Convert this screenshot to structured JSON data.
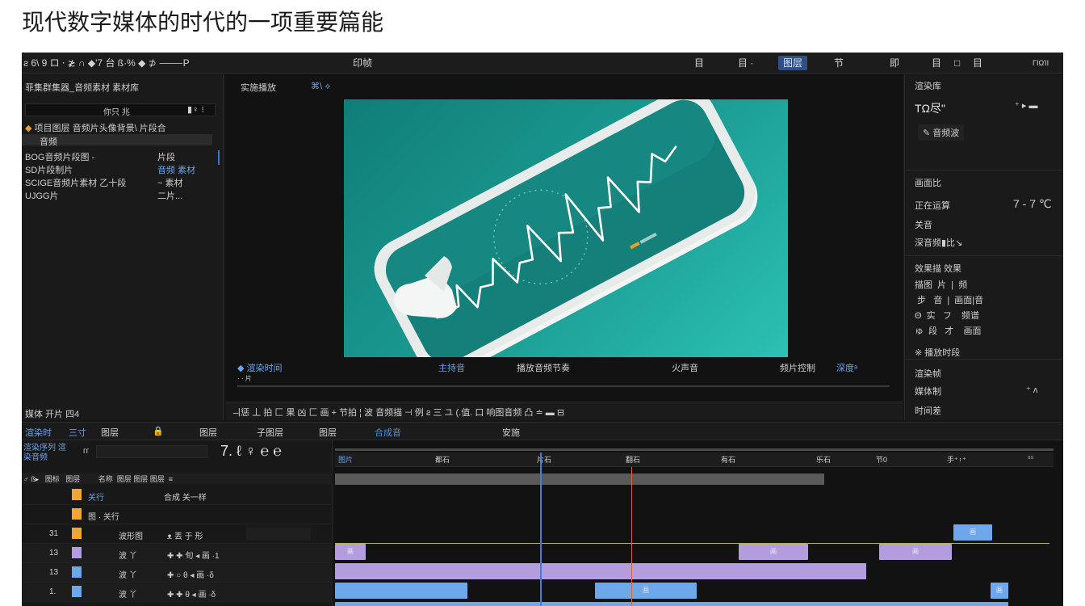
{
  "headline": "现代数字媒体的时代的一项重要篇能",
  "toolbar": {
    "left_icons": "ƨ 6\\ 9   ロ ⸱  ≵ ∩   ◆'7   台 ß·%  ◆  ⊅  ⸻P",
    "item_1": "印帧",
    "item_2": "目",
    "item_3": "目 ·",
    "item_active": "图层",
    "item_4": "节",
    "item_5": "即",
    "item_6": "目",
    "item_7": "□",
    "item_8": "目",
    "item_9": "ΓΙΩΊΙ"
  },
  "left_panel": {
    "title": "菲集群集器_音频素材 素材库",
    "search_text": "你只 兆",
    "search_icons": "▮♀ ⁝",
    "tree_root": "项目图层 音频片头像背景\\ 片段合",
    "tree_folder": "音频",
    "items": [
      {
        "label": "BOG音频片段图 -",
        "value": "片段"
      },
      {
        "label": "SD片段制片",
        "value": "音频 素材"
      },
      {
        "label": "SCIGE音频片素材 乙十段",
        "value": "~ 素材"
      },
      {
        "label": "UJGG片",
        "value": "二片..."
      }
    ],
    "footer": "媒体 开片 四4"
  },
  "viewer": {
    "tab_title": "实施播放",
    "tab_icons": "⌘\\ ⟡",
    "labels": [
      "◆ 渲染时间",
      "主持音",
      "播放音频节奏",
      "火声音",
      "频片控制",
      "深度ᵃ"
    ],
    "small_ticks": "· · 片",
    "tools_bar": "ㅢ惩  丄 拍    匚 果 凶   匚 画 + 节拍  ¦ 波 音频描 ⊣  例   ƨ 三 ユ  (.值.   口 响图音频    凸 ≐  ▬  ⊟"
  },
  "right_panel": {
    "section1_title": "渲染库",
    "value_big": "TΩ尽\"",
    "value_icons": "⁺ ▸ ▬",
    "link": "✎ 音频波",
    "section2_title": "画面比",
    "row1_label": "正在运算",
    "row1_value": "7 - 7 ℃",
    "row2_label": "关音",
    "row3_label": "深音频▮比↘",
    "section3_title": "效果描 效果",
    "grid_text": "描图  片  |  频\n 步   音  |  画面|音\nΘ  实   フ    频谱\nゅ  段   才    画面",
    "row4_label": "※ 播放时段",
    "section4_title": "渲染帧",
    "row5_label": "媒体制",
    "row5_value": "⁺ ʌ",
    "row6_label": "时间差"
  },
  "timeline": {
    "tabs": [
      "渲染时",
      "三寸",
      "图层",
      "🔒",
      "图层",
      "子图层",
      "图层",
      "合成音",
      "安施"
    ],
    "active_tab": "合成音",
    "ctrl_title": "渲染序列 渲染音频",
    "ctrl_sym": "ᴦᴦ",
    "ctrl_icons": "7. ℓ ♀ ℮ ℮",
    "header_cols": "♂ ß▸   图标   图层         名称  图层 图层 图层  ≡",
    "rows": [
      {
        "num": "",
        "name": "关行",
        "extra": "合成 关一样"
      },
      {
        "num": "",
        "name": "图 · 关行",
        "extra": ""
      },
      {
        "num": "31",
        "name": "波形图",
        "extra": "ᴥ  丟 于    形"
      },
      {
        "num": "13",
        "name": "波 丫",
        "extra": "✚ ✚   旬  ◂ 画    ·1"
      },
      {
        "num": "13",
        "name": "波 丫",
        "extra": "✚ ○   θ  ◂ 画    ·δ"
      },
      {
        "num": "1.",
        "name": "波 丫",
        "extra": "✚ ✚   θ  ◂ 画    ·δ"
      }
    ],
    "ruler_ticks": [
      "图片",
      "都石",
      "片石",
      "翻石",
      "有石",
      "乐石",
      "节0",
      "手⁺᛬⁺",
      "⁵⁵"
    ],
    "clip_labels": [
      "画",
      "画",
      "画",
      "画",
      "画",
      "画",
      "画"
    ]
  }
}
